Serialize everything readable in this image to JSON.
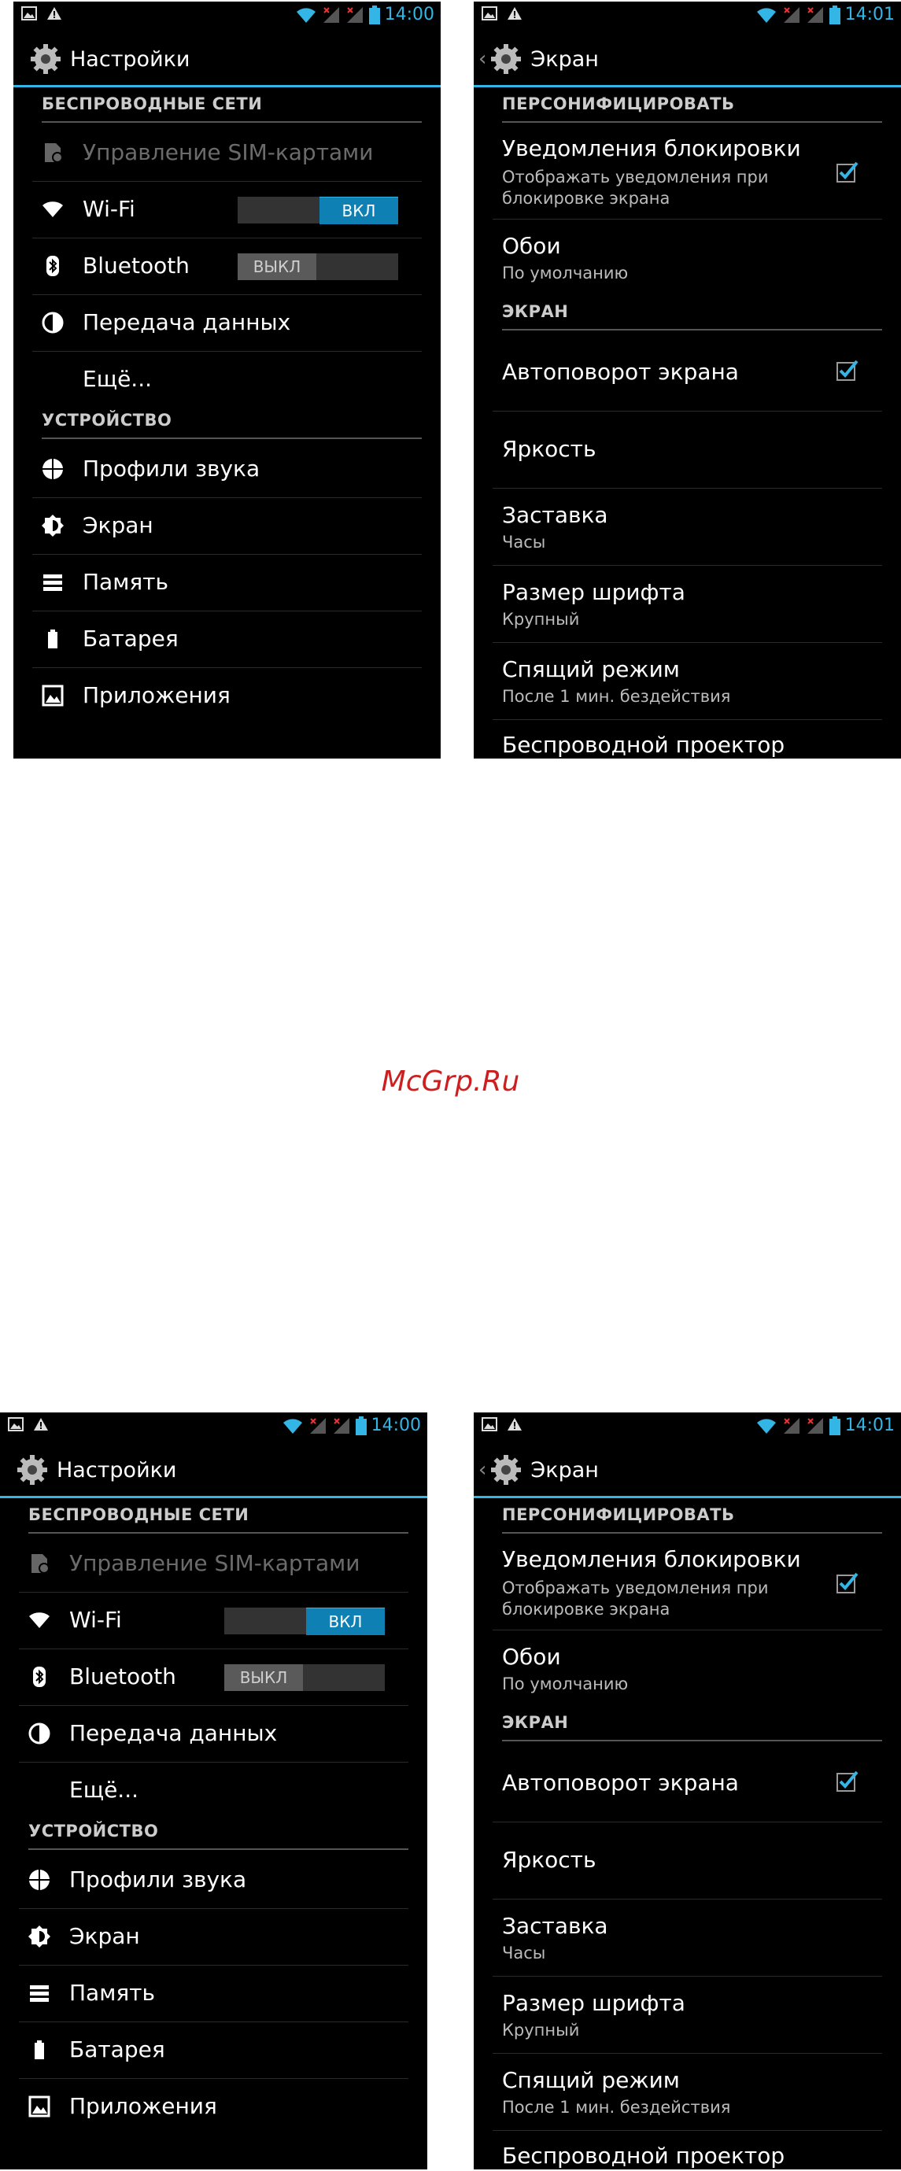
{
  "status": {
    "time_left": "14:00",
    "time_right": "14:01"
  },
  "settings": {
    "title": "Настройки",
    "wireless_header": "БЕСПРОВОДНЫЕ СЕТИ",
    "device_header": "УСТРОЙСТВО",
    "items": {
      "sim": "Управление SIM-картами",
      "wifi": "Wi-Fi",
      "bluetooth": "Bluetooth",
      "data": "Передача данных",
      "more": "Ещё...",
      "sound": "Профили звука",
      "display": "Экран",
      "storage": "Память",
      "battery": "Батарея",
      "apps": "Приложения"
    },
    "wifi_toggle": "ВКЛ",
    "bt_toggle": "ВЫКЛ"
  },
  "display": {
    "title": "Экран",
    "personal_header": "ПЕРСОНИФИЦИРОВАТЬ",
    "screen_header": "ЭКРАН",
    "lock_notifications": {
      "title": "Уведомления блокировки",
      "sub": "Отображать уведомления при блокировке экрана"
    },
    "wallpaper": {
      "title": "Обои",
      "sub": "По умолчанию"
    },
    "autorotate": {
      "title": "Автоповорот экрана"
    },
    "brightness": {
      "title": "Яркость"
    },
    "daydream": {
      "title": "Заставка",
      "sub": "Часы"
    },
    "font_size": {
      "title": "Размер шрифта",
      "sub": "Крупный"
    },
    "sleep": {
      "title": "Спящий режим",
      "sub": "После 1 мин. бездействия"
    },
    "wireless_display": {
      "title": "Беспроводной проектор"
    }
  },
  "watermark": "McGrp.Ru",
  "colors": {
    "accent": "#33b5e5",
    "toggle_on": "#0f80b3",
    "watermark": "#cc2020"
  }
}
